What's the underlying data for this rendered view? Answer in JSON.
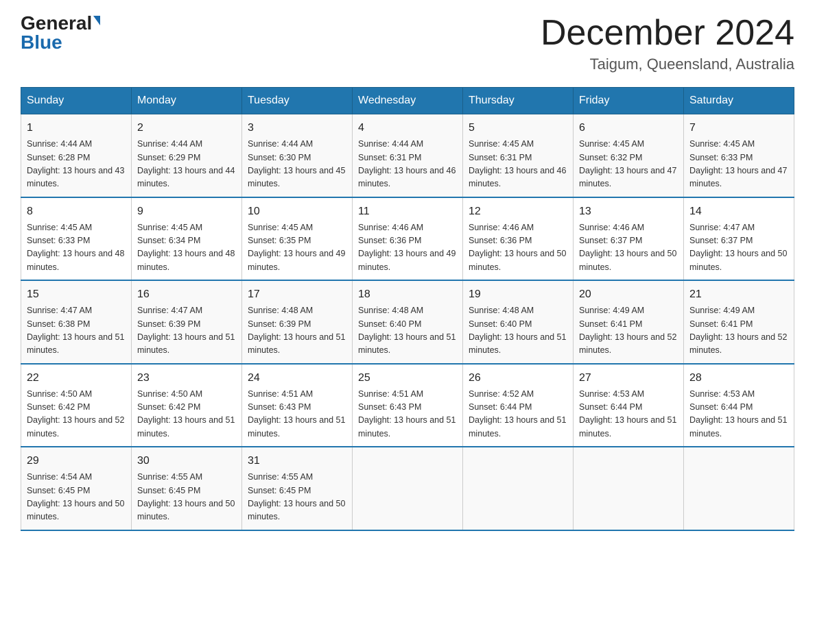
{
  "header": {
    "logo_general": "General",
    "logo_blue": "Blue",
    "month_title": "December 2024",
    "location": "Taigum, Queensland, Australia"
  },
  "days_of_week": [
    "Sunday",
    "Monday",
    "Tuesday",
    "Wednesday",
    "Thursday",
    "Friday",
    "Saturday"
  ],
  "weeks": [
    [
      {
        "day": "1",
        "sunrise": "4:44 AM",
        "sunset": "6:28 PM",
        "daylight": "13 hours and 43 minutes."
      },
      {
        "day": "2",
        "sunrise": "4:44 AM",
        "sunset": "6:29 PM",
        "daylight": "13 hours and 44 minutes."
      },
      {
        "day": "3",
        "sunrise": "4:44 AM",
        "sunset": "6:30 PM",
        "daylight": "13 hours and 45 minutes."
      },
      {
        "day": "4",
        "sunrise": "4:44 AM",
        "sunset": "6:31 PM",
        "daylight": "13 hours and 46 minutes."
      },
      {
        "day": "5",
        "sunrise": "4:45 AM",
        "sunset": "6:31 PM",
        "daylight": "13 hours and 46 minutes."
      },
      {
        "day": "6",
        "sunrise": "4:45 AM",
        "sunset": "6:32 PM",
        "daylight": "13 hours and 47 minutes."
      },
      {
        "day": "7",
        "sunrise": "4:45 AM",
        "sunset": "6:33 PM",
        "daylight": "13 hours and 47 minutes."
      }
    ],
    [
      {
        "day": "8",
        "sunrise": "4:45 AM",
        "sunset": "6:33 PM",
        "daylight": "13 hours and 48 minutes."
      },
      {
        "day": "9",
        "sunrise": "4:45 AM",
        "sunset": "6:34 PM",
        "daylight": "13 hours and 48 minutes."
      },
      {
        "day": "10",
        "sunrise": "4:45 AM",
        "sunset": "6:35 PM",
        "daylight": "13 hours and 49 minutes."
      },
      {
        "day": "11",
        "sunrise": "4:46 AM",
        "sunset": "6:36 PM",
        "daylight": "13 hours and 49 minutes."
      },
      {
        "day": "12",
        "sunrise": "4:46 AM",
        "sunset": "6:36 PM",
        "daylight": "13 hours and 50 minutes."
      },
      {
        "day": "13",
        "sunrise": "4:46 AM",
        "sunset": "6:37 PM",
        "daylight": "13 hours and 50 minutes."
      },
      {
        "day": "14",
        "sunrise": "4:47 AM",
        "sunset": "6:37 PM",
        "daylight": "13 hours and 50 minutes."
      }
    ],
    [
      {
        "day": "15",
        "sunrise": "4:47 AM",
        "sunset": "6:38 PM",
        "daylight": "13 hours and 51 minutes."
      },
      {
        "day": "16",
        "sunrise": "4:47 AM",
        "sunset": "6:39 PM",
        "daylight": "13 hours and 51 minutes."
      },
      {
        "day": "17",
        "sunrise": "4:48 AM",
        "sunset": "6:39 PM",
        "daylight": "13 hours and 51 minutes."
      },
      {
        "day": "18",
        "sunrise": "4:48 AM",
        "sunset": "6:40 PM",
        "daylight": "13 hours and 51 minutes."
      },
      {
        "day": "19",
        "sunrise": "4:48 AM",
        "sunset": "6:40 PM",
        "daylight": "13 hours and 51 minutes."
      },
      {
        "day": "20",
        "sunrise": "4:49 AM",
        "sunset": "6:41 PM",
        "daylight": "13 hours and 52 minutes."
      },
      {
        "day": "21",
        "sunrise": "4:49 AM",
        "sunset": "6:41 PM",
        "daylight": "13 hours and 52 minutes."
      }
    ],
    [
      {
        "day": "22",
        "sunrise": "4:50 AM",
        "sunset": "6:42 PM",
        "daylight": "13 hours and 52 minutes."
      },
      {
        "day": "23",
        "sunrise": "4:50 AM",
        "sunset": "6:42 PM",
        "daylight": "13 hours and 51 minutes."
      },
      {
        "day": "24",
        "sunrise": "4:51 AM",
        "sunset": "6:43 PM",
        "daylight": "13 hours and 51 minutes."
      },
      {
        "day": "25",
        "sunrise": "4:51 AM",
        "sunset": "6:43 PM",
        "daylight": "13 hours and 51 minutes."
      },
      {
        "day": "26",
        "sunrise": "4:52 AM",
        "sunset": "6:44 PM",
        "daylight": "13 hours and 51 minutes."
      },
      {
        "day": "27",
        "sunrise": "4:53 AM",
        "sunset": "6:44 PM",
        "daylight": "13 hours and 51 minutes."
      },
      {
        "day": "28",
        "sunrise": "4:53 AM",
        "sunset": "6:44 PM",
        "daylight": "13 hours and 51 minutes."
      }
    ],
    [
      {
        "day": "29",
        "sunrise": "4:54 AM",
        "sunset": "6:45 PM",
        "daylight": "13 hours and 50 minutes."
      },
      {
        "day": "30",
        "sunrise": "4:55 AM",
        "sunset": "6:45 PM",
        "daylight": "13 hours and 50 minutes."
      },
      {
        "day": "31",
        "sunrise": "4:55 AM",
        "sunset": "6:45 PM",
        "daylight": "13 hours and 50 minutes."
      },
      null,
      null,
      null,
      null
    ]
  ],
  "labels": {
    "sunrise_prefix": "Sunrise: ",
    "sunset_prefix": "Sunset: ",
    "daylight_prefix": "Daylight: "
  }
}
